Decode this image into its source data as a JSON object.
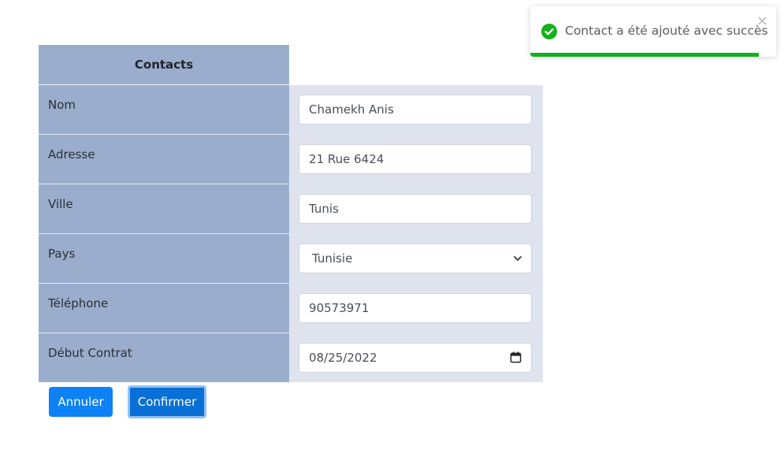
{
  "table": {
    "header": "Contacts"
  },
  "fields": [
    {
      "label": "Nom",
      "value": "Chamekh Anis",
      "type": "text"
    },
    {
      "label": "Adresse",
      "value": "21 Rue 6424",
      "type": "text"
    },
    {
      "label": "Ville",
      "value": "Tunis",
      "type": "text"
    },
    {
      "label": "Pays",
      "value": "Tunisie",
      "type": "select"
    },
    {
      "label": "Téléphone",
      "value": "90573971",
      "type": "text"
    },
    {
      "label": "Début Contrat",
      "value": "08/25/2022",
      "type": "date"
    }
  ],
  "buttons": {
    "cancel": "Annuler",
    "confirm": "Confirmer"
  },
  "toast": {
    "message": "Contact a été ajouté avec succès",
    "close_icon": "close-icon",
    "status_icon": "check-circle-icon",
    "progress": 0.93,
    "color": "#17b01d"
  },
  "colors": {
    "label_bg": "#9aadcd",
    "input_bg": "#dfe3ee",
    "primary": "#0d82f5"
  }
}
